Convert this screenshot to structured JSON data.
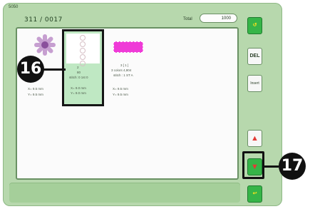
{
  "header": {
    "top_small": "5050",
    "title": "311 / 0017",
    "total_label": "Total",
    "total_value": "1000"
  },
  "designs": [
    {
      "number": "",
      "line1": "",
      "line2": "",
      "x_size": "X= 9.5 mm",
      "y_size": "Y= 9.5 mm"
    },
    {
      "number": "2",
      "line1": "80",
      "line2": "stitch: 0 1st 0",
      "x_size": "X= 9.0 mm",
      "y_size": "Y= 9.0 mm"
    },
    {
      "number": "3 [ 1 ]",
      "line1": "3 colors 4,904",
      "line2": "stitch : 1 ST A",
      "x_size": "X= 9.5 mm",
      "y_size": "Y= 9.5 mm"
    }
  ],
  "buttons": {
    "del": "DEL",
    "insert": "Insert",
    "undo_icon": "undo-arrow-icon",
    "up_icon": "up-arrow-icon",
    "down_icon": "down-arrow-icon",
    "confirm_icon": "return-arrow-icon"
  },
  "callouts": {
    "c16": "16",
    "c17": "17"
  },
  "colors": {
    "panel_bg": "#b7d8ad",
    "selected_bg": "#bfe8c3",
    "accent_green": "#36b548",
    "pink_design": "#ef3bd7"
  }
}
